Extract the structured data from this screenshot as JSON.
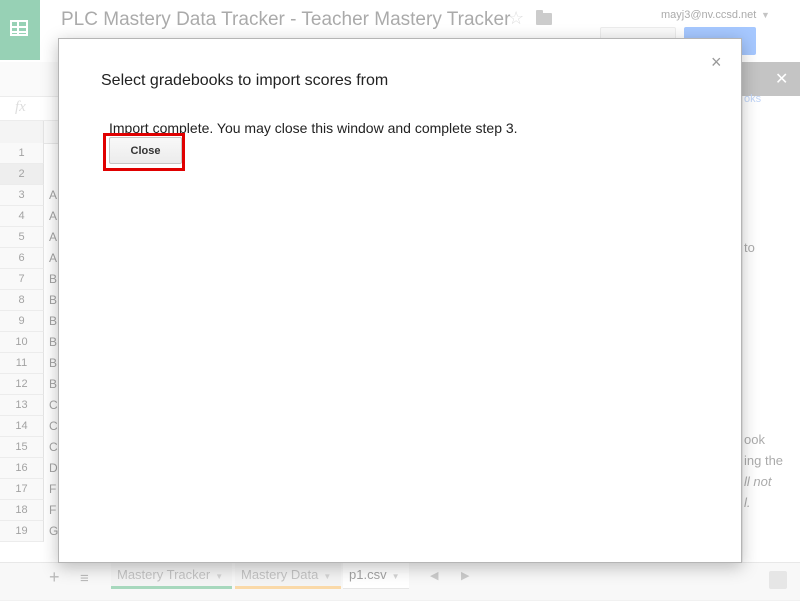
{
  "app": {
    "title": "PLC Mastery Data Tracker - Teacher Mastery Tracker",
    "account": "mayj3@nv.ccsd.net"
  },
  "spreadsheet": {
    "rows": [
      "1",
      "2",
      "3",
      "4",
      "5",
      "6",
      "7",
      "8",
      "9",
      "10",
      "11",
      "12",
      "13",
      "14",
      "15",
      "16",
      "17",
      "18",
      "19"
    ],
    "column_a": [
      "",
      "",
      "A",
      "A",
      "A",
      "A",
      "B",
      "B",
      "B",
      "B",
      "B",
      "B",
      "C",
      "C",
      "C",
      "D",
      "F",
      "F",
      "G"
    ],
    "selected_row": "2"
  },
  "side_panel": {
    "link_fragment": "oks",
    "text_fragments": [
      "to",
      "ook",
      "ing the",
      "ll not",
      "l."
    ]
  },
  "sheet_tabs": [
    {
      "label": "Mastery Tracker",
      "accent": "#4fb07a"
    },
    {
      "label": "Mastery Data",
      "accent": "#f4b350"
    },
    {
      "label": "p1.csv",
      "accent": ""
    }
  ],
  "dialog": {
    "title": "Select gradebooks to import scores from",
    "message": "Import complete. You may close this window and complete step 3.",
    "close_button_label": "Close",
    "dismiss_icon": "×",
    "highlight_color": "#e00000"
  },
  "icons": {
    "logo": "sheets-grid-icon",
    "formula": "fx",
    "star": "☆",
    "add_sheet": "+",
    "all_sheets": "≡"
  }
}
